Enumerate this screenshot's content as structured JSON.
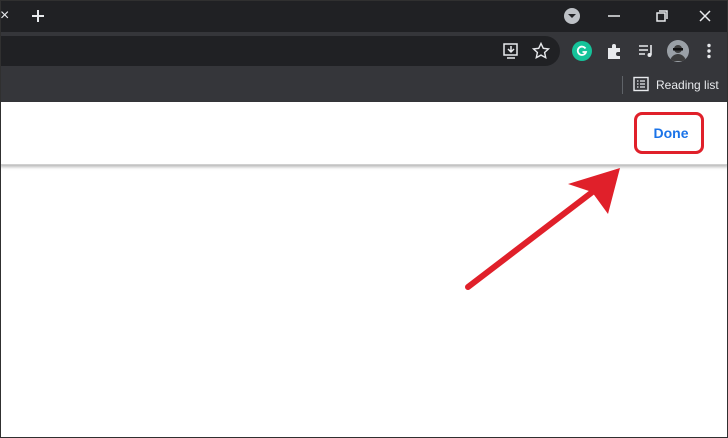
{
  "tabstrip": {
    "tab_close_glyph": "×",
    "icons": [
      "new-tab-icon",
      "tab-search-icon",
      "minimize-icon",
      "restore-icon",
      "close-icon"
    ]
  },
  "toolbar": {
    "icons": [
      "install-app-icon",
      "bookmark-star-icon",
      "grammarly-icon",
      "extensions-icon",
      "media-control-icon",
      "profile-avatar",
      "menu-icon"
    ]
  },
  "bookmarks": {
    "reading_list_label": "Reading list"
  },
  "page": {
    "done_label": "Done"
  },
  "colors": {
    "tabstrip_bg": "#202124",
    "toolbar_bg": "#35363a",
    "done_text": "#1a73e8",
    "annotation_red": "#e0202a",
    "grammarly_green": "#15c39a"
  }
}
